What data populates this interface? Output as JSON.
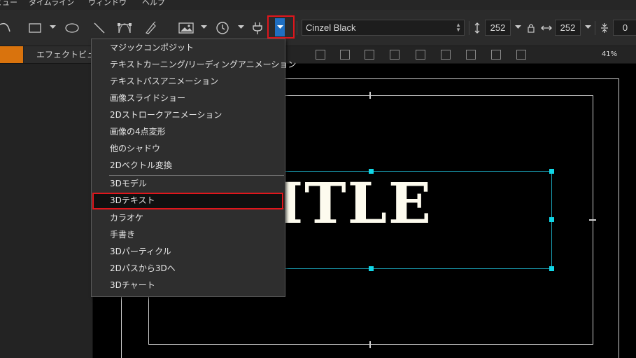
{
  "menubar": {
    "items": [
      "ビュー",
      "タイムライン",
      "ウィンドウ",
      "ヘルプ"
    ]
  },
  "toolbar": {
    "tools": [
      "selection-tool-icon",
      "rectangle-icon",
      "ellipse-icon",
      "line-icon",
      "bezier-icon",
      "pen-icon",
      "image-icon",
      "clock-icon",
      "plugin-icon"
    ],
    "font_name": "Cinzel Black",
    "height_value": "252",
    "width_value": "252",
    "spacing_value": "0"
  },
  "subbar": {
    "effect_tab": "エフェクトビュー",
    "zoom": "41%"
  },
  "canvas": {
    "title_text": "D TITLE"
  },
  "menu": {
    "group1": [
      "マジックコンポジット",
      "テキストカーニング/リーディングアニメーション",
      "テキストパスアニメーション",
      "画像スライドショー",
      "2Dストロークアニメーション",
      "画像の4点変形",
      "他のシャドウ",
      "2Dベクトル変換"
    ],
    "group2": [
      "3Dモデル",
      "3Dテキスト",
      "カラオケ",
      "手書き",
      "3Dパーティクル",
      "2Dパスから3Dへ",
      "3Dチャート"
    ],
    "selected": "3Dテキスト"
  },
  "colors": {
    "highlight": "#e0161c",
    "accent_orange": "#d9730d",
    "selection_cyan": "#11d6e6",
    "dropdown_blue": "#1f6fc2"
  }
}
